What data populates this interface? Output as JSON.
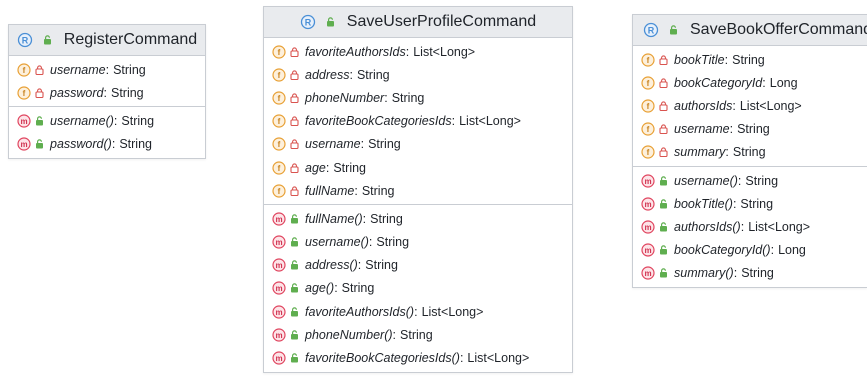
{
  "colors": {
    "header_bg": "#e9ebee",
    "border": "#c9cdd3",
    "field_icon": "#e8a035",
    "method_icon": "#e0455f",
    "record_icon": "#4a8fd6",
    "public_green": "#5fae4f",
    "private_red": "#d9534f"
  },
  "classes": [
    {
      "title": "RegisterCommand",
      "fields": [
        {
          "name": "username",
          "type": "String"
        },
        {
          "name": "password",
          "type": "String"
        }
      ],
      "methods": [
        {
          "name": "username()",
          "type": "String"
        },
        {
          "name": "password()",
          "type": "String"
        }
      ]
    },
    {
      "title": "SaveUserProfileCommand",
      "fields": [
        {
          "name": "favoriteAuthorsIds",
          "type": "List<Long>"
        },
        {
          "name": "address",
          "type": "String"
        },
        {
          "name": "phoneNumber",
          "type": "String"
        },
        {
          "name": "favoriteBookCategoriesIds",
          "type": "List<Long>"
        },
        {
          "name": "username",
          "type": "String"
        },
        {
          "name": "age",
          "type": "String"
        },
        {
          "name": "fullName",
          "type": "String"
        }
      ],
      "methods": [
        {
          "name": "fullName()",
          "type": "String"
        },
        {
          "name": "username()",
          "type": "String"
        },
        {
          "name": "address()",
          "type": "String"
        },
        {
          "name": "age()",
          "type": "String"
        },
        {
          "name": "favoriteAuthorsIds()",
          "type": "List<Long>"
        },
        {
          "name": "phoneNumber()",
          "type": "String"
        },
        {
          "name": "favoriteBookCategoriesIds()",
          "type": "List<Long>"
        }
      ]
    },
    {
      "title": "SaveBookOfferCommand",
      "fields": [
        {
          "name": "bookTitle",
          "type": "String"
        },
        {
          "name": "bookCategoryId",
          "type": "Long"
        },
        {
          "name": "authorsIds",
          "type": "List<Long>"
        },
        {
          "name": "username",
          "type": "String"
        },
        {
          "name": "summary",
          "type": "String"
        }
      ],
      "methods": [
        {
          "name": "username()",
          "type": "String"
        },
        {
          "name": "bookTitle()",
          "type": "String"
        },
        {
          "name": "authorsIds()",
          "type": "List<Long>"
        },
        {
          "name": "bookCategoryId()",
          "type": "Long"
        },
        {
          "name": "summary()",
          "type": "String"
        }
      ]
    }
  ]
}
